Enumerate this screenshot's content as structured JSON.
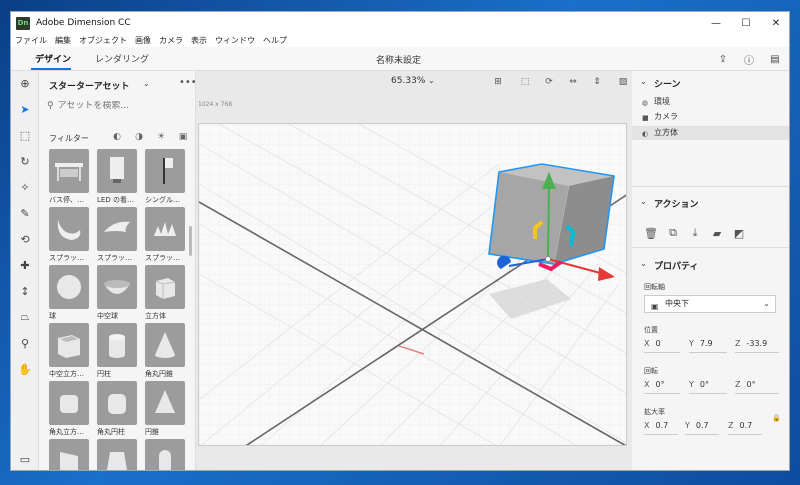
{
  "window": {
    "title": "Adobe Dimension CC",
    "app_badge": "Dn"
  },
  "menu": [
    "ファイル",
    "編集",
    "オブジェクト",
    "画像",
    "カメラ",
    "表示",
    "ウィンドウ",
    "ヘルプ"
  ],
  "tabs": [
    {
      "label": "デザイン"
    },
    {
      "label": "レンダリング"
    }
  ],
  "document_title": "名称未設定",
  "assets": {
    "title": "スターターアセット",
    "search_placeholder": "アセットを検索...",
    "filter_label": "フィルター",
    "items": [
      {
        "label": "バス停、…"
      },
      {
        "label": "LED の看…"
      },
      {
        "label": "シングル…"
      },
      {
        "label": "スプラッ…"
      },
      {
        "label": "スプラッ…"
      },
      {
        "label": "スプラッ…"
      },
      {
        "label": "球"
      },
      {
        "label": "中空球"
      },
      {
        "label": "立方体"
      },
      {
        "label": "中空立方…"
      },
      {
        "label": "円柱"
      },
      {
        "label": "角丸円錐"
      },
      {
        "label": "角丸立方…"
      },
      {
        "label": "角丸円柱"
      },
      {
        "label": "円錐"
      },
      {
        "label": ""
      },
      {
        "label": ""
      },
      {
        "label": ""
      }
    ]
  },
  "viewport": {
    "zoom": "65.33%",
    "artboard_size": "1024 x 768"
  },
  "scene": {
    "title": "シーン",
    "items": [
      {
        "label": "環境",
        "icon": "globe-icon"
      },
      {
        "label": "カメラ",
        "icon": "camera-icon"
      },
      {
        "label": "立方体",
        "icon": "cube-icon",
        "selected": true
      }
    ]
  },
  "actions": {
    "title": "アクション"
  },
  "properties": {
    "title": "プロパティ",
    "pivot_label": "回転軸",
    "pivot_value": "中央下",
    "position_label": "位置",
    "position": {
      "x": "0",
      "y": "7.9",
      "z": "-33.9"
    },
    "rotation_label": "回転",
    "rotation": {
      "x": "0°",
      "y": "0°",
      "z": "0°"
    },
    "scale_label": "拡大率",
    "scale": {
      "x": "0.7",
      "y": "0.7",
      "z": "0.7"
    }
  },
  "colors": {
    "accent": "#1473e6",
    "gizmo_green": "#4caf50",
    "gizmo_red": "#e53935",
    "gizmo_blue": "#1e63d6",
    "gizmo_yellow": "#f5c518",
    "gizmo_cyan": "#00bcd4",
    "gizmo_magenta": "#e91e63"
  }
}
